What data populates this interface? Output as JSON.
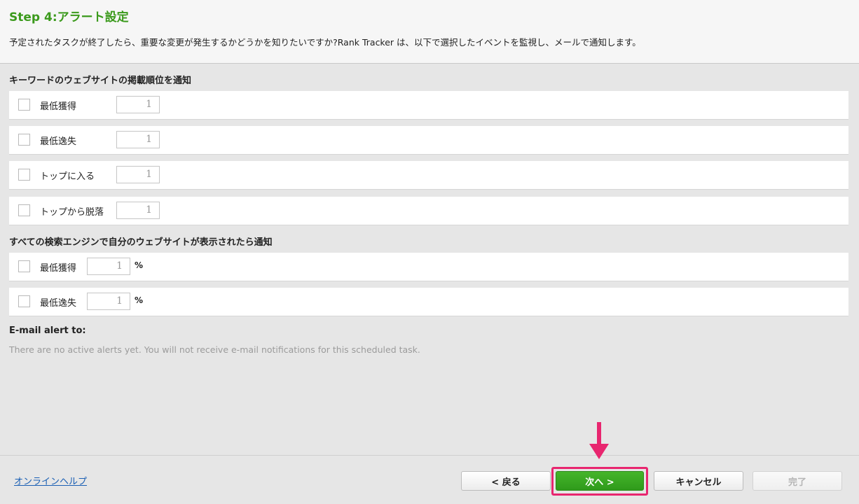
{
  "header": {
    "title": "Step 4:アラート設定",
    "description": "予定されたタスクが終了したら、重要な変更が発生するかどうかを知りたいですか?Rank Tracker は、以下で選択したイベントを監視し、メールで通知します。"
  },
  "keyword_section": {
    "title": "キーワードのウェブサイトの掲載順位を通知",
    "rows": [
      {
        "label": "最低獲得",
        "value": "1"
      },
      {
        "label": "最低逸失",
        "value": "1"
      },
      {
        "label": "トップに入る",
        "value": "1"
      },
      {
        "label": "トップから脱落",
        "value": "1"
      }
    ]
  },
  "engine_section": {
    "title": "すべての検索エンジンで自分のウェブサイトが表示されたら通知",
    "rows": [
      {
        "label": "最低獲得",
        "value": "1",
        "unit": "%"
      },
      {
        "label": "最低逸失",
        "value": "1",
        "unit": "%"
      }
    ]
  },
  "email": {
    "title": "E-mail alert to:",
    "description": "There are no active alerts yet. You will not receive e-mail notifications for this scheduled task."
  },
  "footer": {
    "help_link": "オンラインヘルプ",
    "back_label": "< 戻る",
    "next_label": "次へ >",
    "cancel_label": "キャンセル",
    "finish_label": "完了"
  },
  "colors": {
    "accent_green": "#3b9a1c",
    "highlight_pink": "#e8266f",
    "link_blue": "#1a5fb4"
  }
}
